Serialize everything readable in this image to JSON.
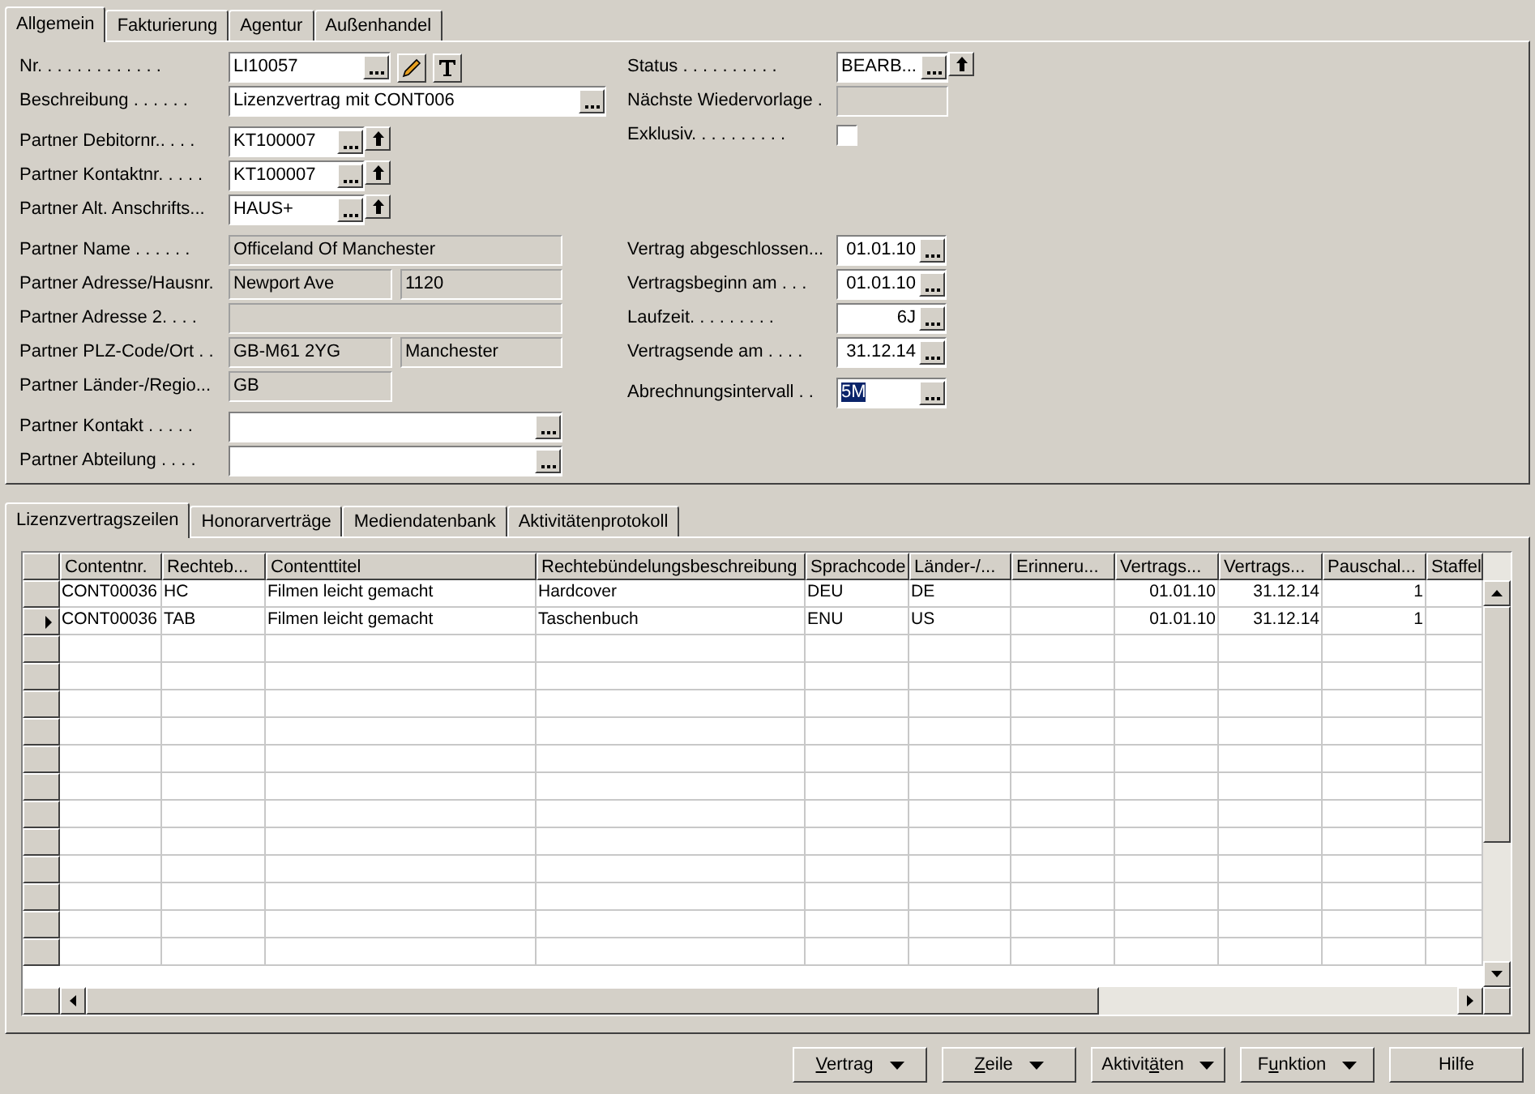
{
  "top_tabs": [
    {
      "label": "Allgemein",
      "selected": true
    },
    {
      "label": "Fakturierung",
      "selected": false
    },
    {
      "label": "Agentur",
      "selected": false
    },
    {
      "label": "Außenhandel",
      "selected": false
    }
  ],
  "left_groups": [
    [
      {
        "label": "Nr. . . . . . . . . . . . .",
        "kind": "nr",
        "value": "LI10057"
      },
      {
        "label": "Beschreibung . . . . . .",
        "kind": "lookup_wide",
        "value": "Lizenzvertrag mit CONT006"
      }
    ],
    [
      {
        "label": "Partner Debitornr.. . . .",
        "kind": "lookup_drill",
        "value": "KT100007"
      },
      {
        "label": "Partner Kontaktnr. . . . .",
        "kind": "lookup_drill",
        "value": "KT100007"
      },
      {
        "label": "Partner Alt. Anschrifts...",
        "kind": "lookup_drill",
        "value": "HAUS+"
      }
    ],
    [
      {
        "label": "Partner Name . . . . . .",
        "kind": "readonly_wide",
        "value": "Officeland Of Manchester"
      },
      {
        "label": "Partner Adresse/Hausnr.",
        "kind": "readonly_pair",
        "values": [
          "Newport Ave",
          "1120"
        ]
      },
      {
        "label": "Partner Adresse 2. . . .",
        "kind": "readonly_wide"
      },
      {
        "label": "Partner PLZ-Code/Ort . .",
        "kind": "readonly_pair",
        "values": [
          "GB-M61 2YG",
          "Manchester"
        ]
      },
      {
        "label": "Partner Länder-/Regio...",
        "kind": "readonly_short",
        "value": "GB"
      }
    ],
    [
      {
        "label": "Partner Kontakt . . . . .",
        "kind": "lookup_medium"
      },
      {
        "label": "Partner Abteilung . . . .",
        "kind": "lookup_medium"
      }
    ]
  ],
  "right_groups": [
    [
      {
        "label": "Status . . . . . . . . . .",
        "kind": "status",
        "value": "BEARB..."
      },
      {
        "label": "Nächste Wiedervorlage .",
        "kind": "readonly_small"
      },
      {
        "label": "Exklusiv. . . . . . . . . .",
        "kind": "checkbox",
        "checked": false
      }
    ],
    [
      {
        "label": "Vertrag abgeschlossen...",
        "kind": "date",
        "value": "01.01.10"
      },
      {
        "label": "Vertragsbeginn am . . .",
        "kind": "date",
        "value": "01.01.10"
      },
      {
        "label": "Laufzeit. . . . . . . . .",
        "kind": "date",
        "value": "6J"
      },
      {
        "label": "Vertragsende am . . . .",
        "kind": "date",
        "value": "31.12.14"
      }
    ],
    [
      {
        "label": "Abrechnungsintervall . .",
        "kind": "narrow",
        "value": "5M",
        "text_selected": true
      }
    ]
  ],
  "sub_tabs": [
    {
      "label": "Lizenzvertragszeilen",
      "selected": true
    },
    {
      "label": "Honorarverträge",
      "selected": false
    },
    {
      "label": "Mediendatenbank",
      "selected": false
    },
    {
      "label": "Aktivitätenprotokoll",
      "selected": false
    }
  ],
  "table": {
    "columns": [
      {
        "label": "Contentnr.",
        "kind": "text"
      },
      {
        "label": "Rechteb...",
        "kind": "text"
      },
      {
        "label": "Contenttitel",
        "kind": "text"
      },
      {
        "label": "Rechtebündelungsbeschreibung",
        "kind": "text"
      },
      {
        "label": "Sprachcode",
        "kind": "text"
      },
      {
        "label": "Länder-/...",
        "kind": "text"
      },
      {
        "label": "Erinneru...",
        "kind": "text"
      },
      {
        "label": "Vertrags...",
        "kind": "number"
      },
      {
        "label": "Vertrags...",
        "kind": "number"
      },
      {
        "label": "Pauschal...",
        "kind": "number"
      },
      {
        "label": "Staffel",
        "kind": "text"
      }
    ],
    "rows": [
      {
        "selected": false,
        "cells": [
          "CONT00036",
          "HC",
          "Filmen leicht gemacht",
          "Hardcover",
          "DEU",
          "DE",
          "",
          "01.01.10",
          "31.12.14",
          "1",
          ""
        ]
      },
      {
        "selected": true,
        "cells": [
          "CONT00036",
          "TAB",
          "Filmen leicht gemacht",
          "Taschenbuch",
          "ENU",
          "US",
          "",
          "01.01.10",
          "31.12.14",
          "1",
          ""
        ]
      }
    ]
  },
  "buttons": [
    {
      "key": "V",
      "post": "ertrag",
      "dropdown": true
    },
    {
      "key": "Z",
      "post": "eile",
      "dropdown": true
    },
    {
      "pre": "Aktivit",
      "key": "ä",
      "post": "ten",
      "dropdown": true
    },
    {
      "pre": "F",
      "key": "u",
      "post": "nktion",
      "dropdown": true
    },
    {
      "pre": "Hilfe",
      "dropdown": false
    }
  ]
}
